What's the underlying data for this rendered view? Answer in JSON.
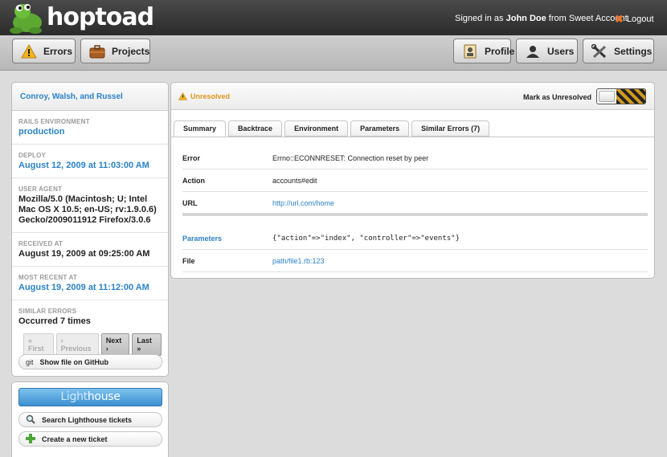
{
  "app": {
    "logo_text": "hoptoad"
  },
  "topbar": {
    "signed_in_prefix": "Signed in as",
    "user_name": "John Doe",
    "account_text": "from Sweet Account",
    "logout_label": "Logout"
  },
  "nav": {
    "errors_label": "Errors",
    "projects_label": "Projects",
    "profile_label": "Profile",
    "users_label": "Users",
    "settings_label": "Settings"
  },
  "sidebar": {
    "header": "Conroy, Walsh, and Russel",
    "rails_env_label": "RAILS ENVIRONMENT",
    "rails_env_value": "production",
    "deploy_label": "DEPLOY",
    "deploy_value": "August 12, 2009 at 11:03:00 AM",
    "user_agent_label": "USER AGENT",
    "user_agent_value": "Mozilla/5.0 (Macintosh; U; Intel Mac OS X 10.5; en-US; rv:1.9.0.6) Gecko/2009011912 Firefox/3.0.6",
    "received_label": "RECEIVED AT",
    "received_value": "August 19, 2009 at 09:25:00 AM",
    "recent_label": "MOST RECENT AT",
    "recent_value": "August 19, 2009 at 11:12:00 AM",
    "similar_label": "SIMILAR ERRORS",
    "similar_value": "Occurred 7 times",
    "pager": {
      "first": "« First",
      "previous": "‹ Previous",
      "next": "Next ›",
      "last": "Last »"
    },
    "github_badge": "git",
    "github_label": "Show file on GitHub"
  },
  "lighthouse": {
    "banner_a": "Light",
    "banner_b": "house",
    "search_label": "Search Lighthouse tickets",
    "create_label": "Create a new ticket"
  },
  "main": {
    "status": "Unresolved",
    "mark_label": "Mark as Unresolved",
    "tabs": [
      "Summary",
      "Backtrace",
      "Environment",
      "Parameters",
      "Similar Errors (7)"
    ],
    "rows": {
      "error_key": "Error",
      "error_val": "Errno::ECONNRESET: Connection reset by peer",
      "action_key": "Action",
      "action_val": "accounts#edit",
      "url_key": "URL",
      "url_val": "http://url.com/home",
      "params_key": "Parameters",
      "params_val": "{\"action\"=>\"index\", \"controller\"=>\"events\"}",
      "file_key": "File",
      "file_val": "path/file1.rb:123"
    }
  },
  "colors": {
    "accent": "#2a82c8",
    "warning": "#e0961d",
    "topbar": "#333333"
  }
}
